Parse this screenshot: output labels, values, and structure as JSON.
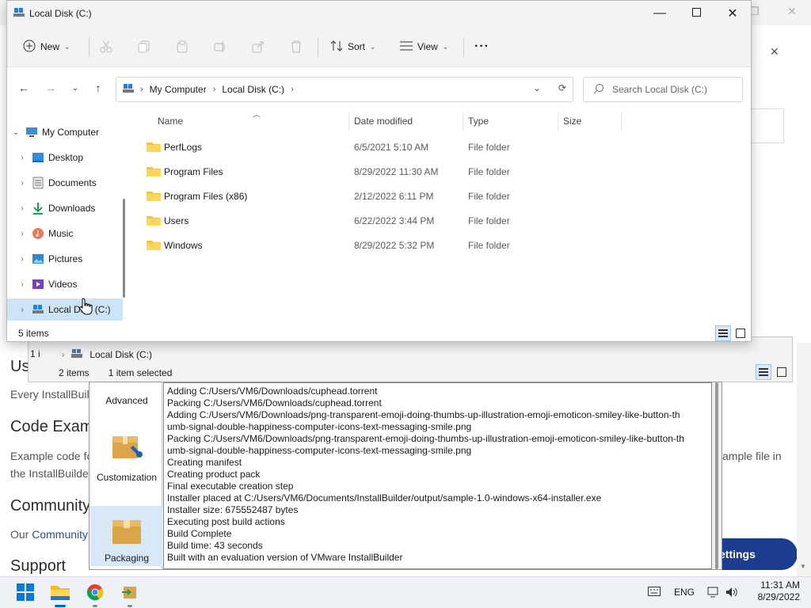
{
  "background_page": {
    "headings": [
      "User",
      "Code Exam",
      "Community",
      "Support"
    ],
    "paragraphs": [
      "Every InstallBuil",
      "Example code fo",
      "the InstallBuilde"
    ],
    "community_text_prefix": "Our ",
    "community_link": "Community",
    "right_text": "xample file in",
    "settings_button": "ettings"
  },
  "explorer2": {
    "tree_item": "Local Disk (C:)",
    "items_count": "2 items",
    "selected": "1 item selected",
    "tree_partial": "1 i"
  },
  "installbuilder": {
    "sidebar": [
      {
        "label": "Advanced"
      },
      {
        "label": "Customization"
      },
      {
        "label": "Packaging"
      }
    ],
    "log_lines": [
      "Adding C:/Users/VM6/Downloads/cuphead.torrent",
      "Packing C:/Users/VM6/Downloads/cuphead.torrent",
      "Adding C:/Users/VM6/Downloads/png-transparent-emoji-doing-thumbs-up-illustration-emoji-emoticon-smiley-like-button-th",
      "umb-signal-double-happiness-computer-icons-text-messaging-smile.png",
      "Packing C:/Users/VM6/Downloads/png-transparent-emoji-doing-thumbs-up-illustration-emoji-emoticon-smiley-like-button-th",
      "umb-signal-double-happiness-computer-icons-text-messaging-smile.png",
      "Creating manifest",
      "Creating product pack",
      "Final executable creation step",
      "Installer placed at C:/Users/VM6/Documents/InstallBuilder/output/sample-1.0-windows-x64-installer.exe",
      "Installer size: 675552487 bytes",
      "Executing post build actions",
      "Build Complete",
      "Build time: 43 seconds",
      "Built with an evaluation version of VMware InstallBuilder"
    ]
  },
  "explorer": {
    "title": "Local Disk (C:)",
    "toolbar": {
      "new_label": "New",
      "sort_label": "Sort",
      "view_label": "View",
      "more_label": "···"
    },
    "address": {
      "crumbs": [
        "My Computer",
        "Local Disk (C:)"
      ]
    },
    "search_placeholder": "Search Local Disk (C:)",
    "tree": [
      {
        "label": "My Computer",
        "icon": "computer-icon",
        "expanded": true
      },
      {
        "label": "Desktop",
        "icon": "desktop-icon"
      },
      {
        "label": "Documents",
        "icon": "documents-icon"
      },
      {
        "label": "Downloads",
        "icon": "downloads-icon"
      },
      {
        "label": "Music",
        "icon": "music-icon"
      },
      {
        "label": "Pictures",
        "icon": "pictures-icon"
      },
      {
        "label": "Videos",
        "icon": "videos-icon"
      },
      {
        "label": "Local Disk (C:)",
        "icon": "drive-icon",
        "selected": true
      }
    ],
    "columns": {
      "name": "Name",
      "date": "Date modified",
      "type": "Type",
      "size": "Size"
    },
    "files": [
      {
        "name": "PerfLogs",
        "date": "6/5/2021 5:10 AM",
        "type": "File folder"
      },
      {
        "name": "Program Files",
        "date": "8/29/2022 11:30 AM",
        "type": "File folder"
      },
      {
        "name": "Program Files (x86)",
        "date": "2/12/2022 6:11 PM",
        "type": "File folder"
      },
      {
        "name": "Users",
        "date": "6/22/2022 3:44 PM",
        "type": "File folder"
      },
      {
        "name": "Windows",
        "date": "8/29/2022 5:32 PM",
        "type": "File folder"
      }
    ],
    "status_count": "5 items"
  },
  "taskbar": {
    "tray_language": "ENG",
    "time": "11:31 AM",
    "date": "8/29/2022"
  },
  "colors": {
    "accent": "#0067c0",
    "folder": "#f5c342",
    "selection": "#cce4f7",
    "settings_button": "#1c3d8f"
  }
}
